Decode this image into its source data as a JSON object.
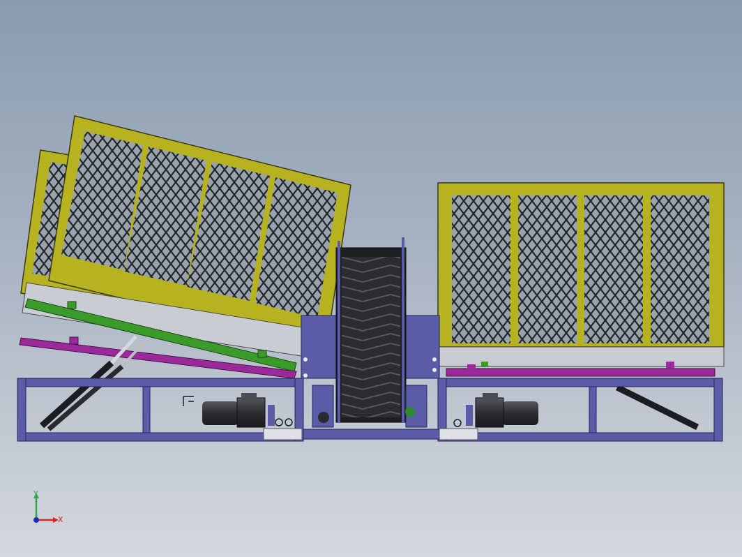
{
  "triad": {
    "y_label": "Y",
    "x_label": "X",
    "y_color": "#2ea84a",
    "x_color": "#d8232a",
    "z_color": "#1b2fb5"
  },
  "colors": {
    "frame_blue": "#5a5ca8",
    "cage_yellow": "#b7b21f",
    "rail_green": "#3a9a2a",
    "rail_magenta": "#9a2a9a",
    "motor_dark": "#2f2f33",
    "mesh_dark": "#1f2426"
  }
}
